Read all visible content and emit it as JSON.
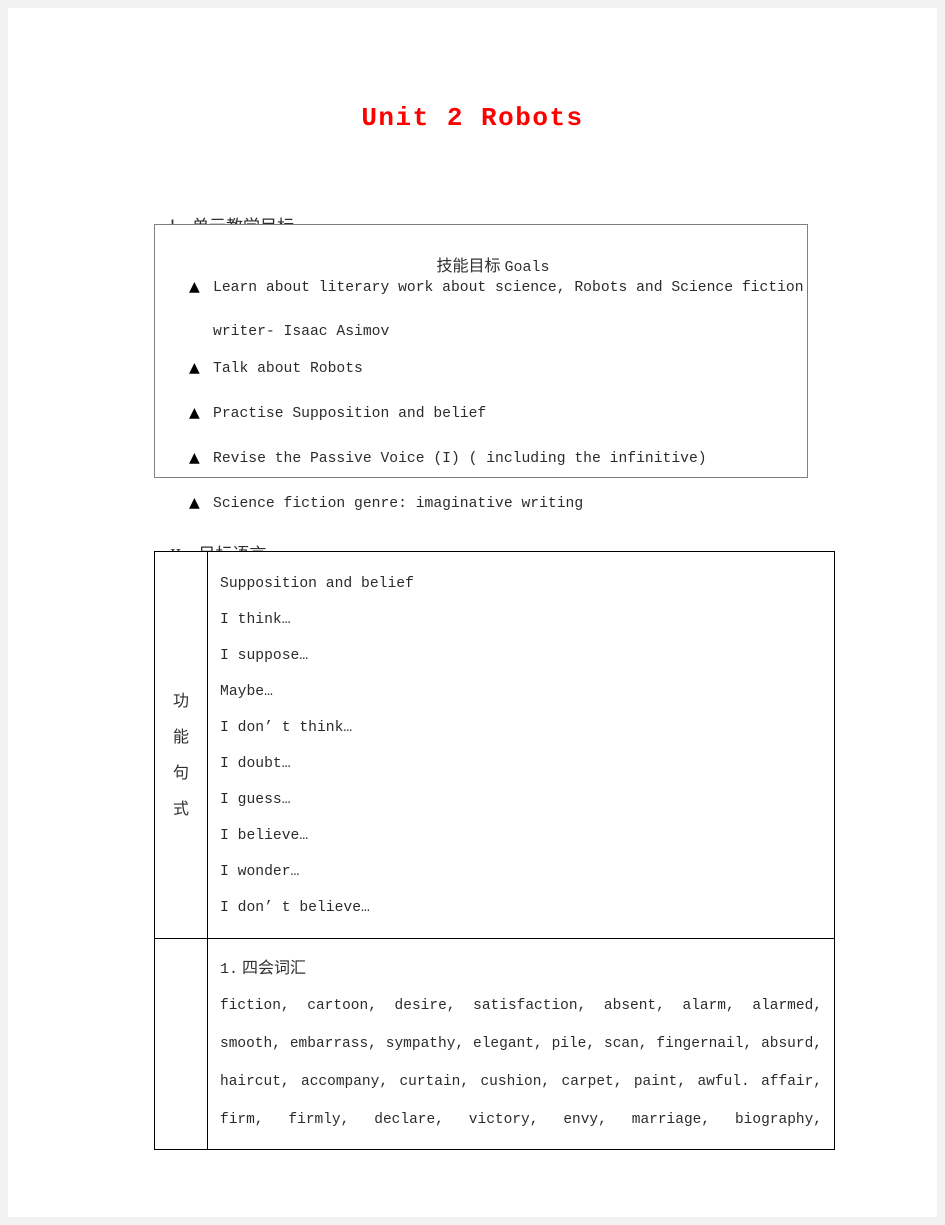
{
  "document": {
    "title": "Unit 2 Robots",
    "title_color": "#ff0000"
  },
  "section_one": {
    "number": "Ⅰ.",
    "heading": "单元教学目标",
    "box": {
      "title_cn": "技能目标",
      "title_en": "Goals",
      "bullet_glyph": "▲",
      "items": [
        {
          "text": "Learn about literary work about science, Robots and Science fiction",
          "continuation": "writer- Isaac Asimov"
        },
        {
          "text": "Talk about Robots",
          "continuation": ""
        },
        {
          "text": "Practise Supposition and belief",
          "continuation": ""
        },
        {
          "text": "Revise the Passive Voice (I) ( including the infinitive)",
          "continuation": ""
        },
        {
          "text": "Science fiction genre: imaginative writing",
          "continuation": ""
        }
      ]
    }
  },
  "section_two": {
    "number": "II.",
    "heading": "目标语言",
    "table": {
      "row_function": {
        "label_chars": [
          "功",
          "能",
          "句",
          "式"
        ],
        "lines": [
          "Supposition and belief",
          "I think…",
          "I suppose…",
          "Maybe…",
          "I don’ t think…",
          "I doubt…",
          "I guess…",
          "I believe…",
          "I wonder…",
          "I don’ t believe…"
        ]
      },
      "row_vocab": {
        "label_chars": [],
        "heading_num": "1.",
        "heading_cn": "四会词汇",
        "lines": [
          "fiction, cartoon, desire, satisfaction, absent, alarm, alarmed,",
          "smooth, embarrass, sympathy, elegant, pile, scan, fingernail, absurd,",
          "haircut, accompany, curtain, cushion, carpet, paint, awful. affair,",
          "firm, firmly, declare, victory, envy, marriage, biography,"
        ]
      }
    }
  }
}
